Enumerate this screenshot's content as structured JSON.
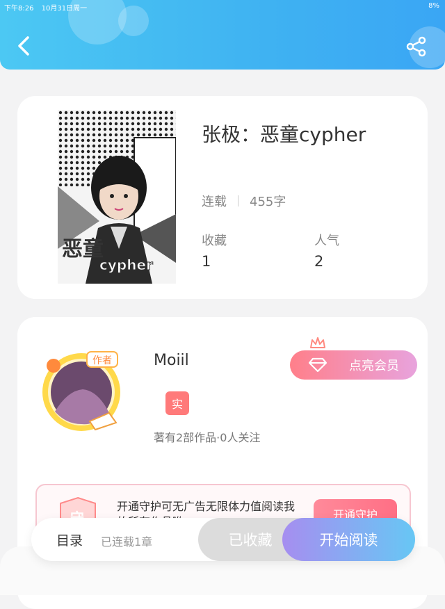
{
  "status_bar": {
    "time": "下午8:26",
    "date": "10月31日周一",
    "battery": "8%"
  },
  "book": {
    "title": "张极：恶童cypher",
    "status": "连载",
    "word_count": "455字",
    "favorites_label": "收藏",
    "favorites_value": "1",
    "popularity_label": "人气",
    "popularity_value": "2"
  },
  "author": {
    "name": "Moiil",
    "badge": "实",
    "works_info": "著有2部作品·0人关注",
    "vip_button": "点亮会员",
    "avatar_tag": "作者"
  },
  "guard": {
    "icon_text": "守",
    "description": "开通守护可无广告无限体力值阅读我的所有作品哟",
    "button": "开通守护"
  },
  "bottom_bar": {
    "toc_label": "目录",
    "chapters_label": "已连载1章",
    "collected_label": "已收藏",
    "read_label": "开始阅读"
  },
  "colors": {
    "header": "#3fb2f2",
    "vip": "#ff7f8a",
    "read_start": "#a68ef0",
    "read_end": "#67c7f4"
  },
  "icons": [
    "back-arrow-icon",
    "share-icon",
    "crown-icon",
    "diamond-icon",
    "guard-shield-icon"
  ]
}
